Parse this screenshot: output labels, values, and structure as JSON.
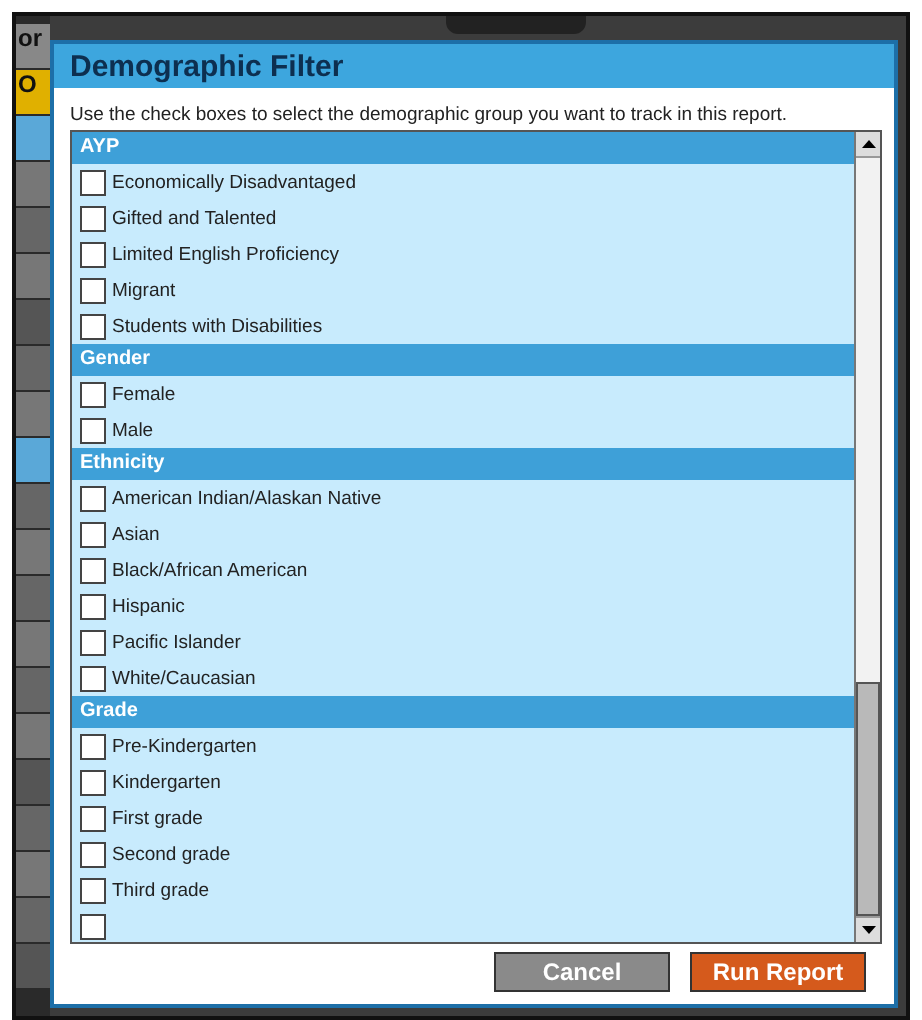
{
  "background": {
    "labels": [
      "or",
      "O"
    ]
  },
  "dialog": {
    "title": "Demographic Filter",
    "instructions": "Use the check boxes to select the demographic group you want to track in this report.",
    "groups": [
      {
        "header": "AYP",
        "items": [
          {
            "label": "Economically Disadvantaged",
            "checked": false
          },
          {
            "label": "Gifted and Talented",
            "checked": false
          },
          {
            "label": "Limited English Proficiency",
            "checked": false
          },
          {
            "label": "Migrant",
            "checked": false
          },
          {
            "label": "Students with Disabilities",
            "checked": false
          }
        ]
      },
      {
        "header": "Gender",
        "items": [
          {
            "label": "Female",
            "checked": false
          },
          {
            "label": "Male",
            "checked": false
          }
        ]
      },
      {
        "header": "Ethnicity",
        "items": [
          {
            "label": "American Indian/Alaskan Native",
            "checked": false
          },
          {
            "label": "Asian",
            "checked": false
          },
          {
            "label": "Black/African American",
            "checked": false
          },
          {
            "label": "Hispanic",
            "checked": false
          },
          {
            "label": "Pacific Islander",
            "checked": false
          },
          {
            "label": "White/Caucasian",
            "checked": false
          }
        ]
      },
      {
        "header": "Grade",
        "items": [
          {
            "label": "Pre-Kindergarten",
            "checked": false
          },
          {
            "label": "Kindergarten",
            "checked": false
          },
          {
            "label": "First grade",
            "checked": false
          },
          {
            "label": "Second grade",
            "checked": false
          },
          {
            "label": "Third grade",
            "checked": false
          },
          {
            "checked": false
          }
        ]
      }
    ],
    "buttons": [
      {
        "label": "Cancel",
        "kind": "secondary"
      },
      {
        "label": "Run Report",
        "kind": "primary"
      }
    ]
  }
}
